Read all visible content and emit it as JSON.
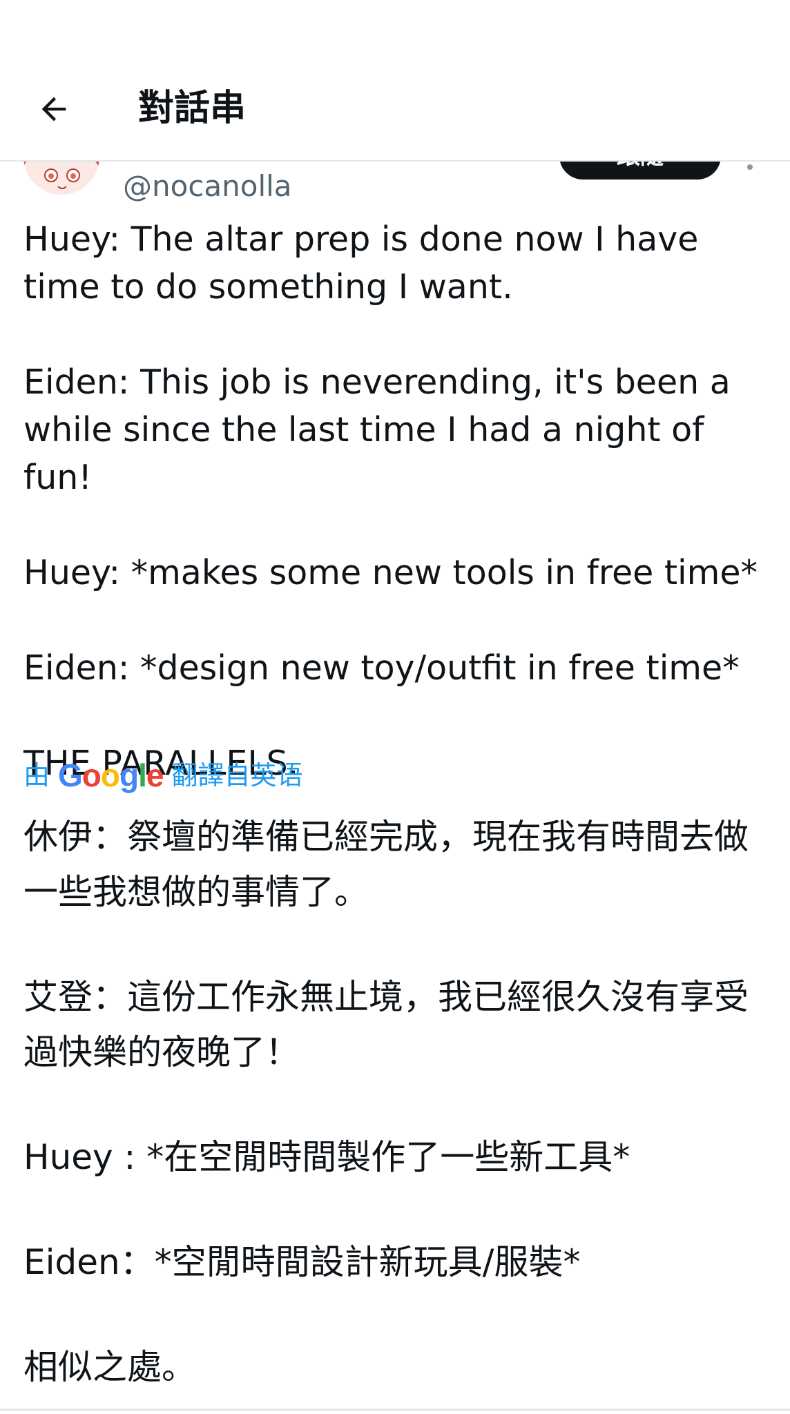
{
  "header": {
    "title": "對話串",
    "back_icon": "arrow-left-icon"
  },
  "tweet": {
    "handle": "@nocanolla",
    "follow_label": "跟隨",
    "paragraphs": [
      "Huey: The altar prep is done now I have time to do something I want.",
      "Eiden: This job is neverending, it's been a while since the last time I had a night of fun!",
      "Huey: *makes some new tools in free time*",
      "Eiden: *design new toy/outfit in free time*",
      "THE PARALLELS."
    ],
    "translation": {
      "prefix": "由",
      "provider": "Google",
      "suffix": "翻譯自英语",
      "paragraphs": [
        "休伊：祭壇的準備已經完成，現在我有時間去做一些我想做的事情了。",
        "艾登：這份工作永無止境，我已經很久沒有享受過快樂的夜晚了！",
        "Huey : *在空閒時間製作了一些新工具*",
        "Eiden：*空閒時間設計新玩具/服裝*",
        "相似之處。"
      ]
    }
  },
  "colors": {
    "text": "#0f1419",
    "secondary": "#536471",
    "link": "#1d9bf0",
    "divider": "#e4e8eb"
  }
}
